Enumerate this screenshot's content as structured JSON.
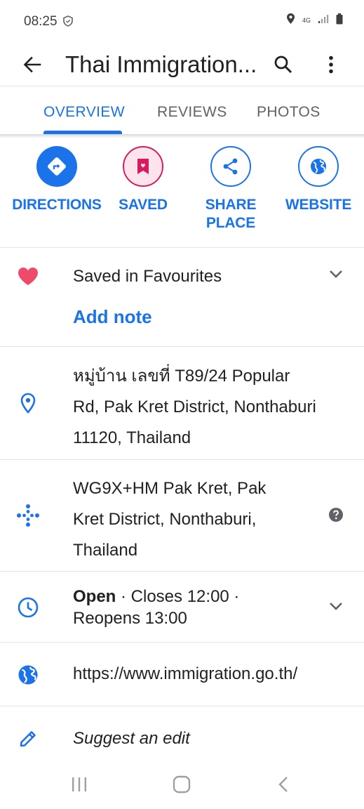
{
  "status_bar": {
    "time": "08:25",
    "network": "4G"
  },
  "app_bar": {
    "title": "Thai Immigration..."
  },
  "tabs": [
    {
      "label": "OVERVIEW",
      "active": true
    },
    {
      "label": "REVIEWS",
      "active": false
    },
    {
      "label": "PHOTOS",
      "active": false
    }
  ],
  "actions": {
    "directions": {
      "label": "DIRECTIONS",
      "icon": "directions-icon"
    },
    "saved": {
      "label": "SAVED",
      "icon": "bookmark-icon"
    },
    "share": {
      "label_line1": "SHARE",
      "label_line2": "PLACE",
      "icon": "share-icon"
    },
    "website": {
      "label": "WEBSITE",
      "icon": "globe-icon"
    }
  },
  "saved_row": {
    "text": "Saved in Favourites",
    "add_note": "Add note",
    "icon": "heart-icon"
  },
  "address": {
    "line1": "หมู่บ้าน เลขที่ T89/24 Popular",
    "line2": "Rd, Pak Kret District, Nonthaburi",
    "line3": "11120, Thailand"
  },
  "plus_code": {
    "line1": "WG9X+HM Pak Kret, Pak",
    "line2": "Kret District, Nonthaburi,",
    "line3": "Thailand"
  },
  "hours": {
    "status": "Open",
    "line1_rest": " · Closes 12:00 ·",
    "line2": "Reopens 13:00"
  },
  "website_row": {
    "url": "https://www.immigration.go.th/"
  },
  "suggest_edit": {
    "text": "Suggest an edit"
  },
  "colors": {
    "accent": "#1a73e8",
    "saved_pink": "#d81b60",
    "heart": "#ee4b6a"
  }
}
